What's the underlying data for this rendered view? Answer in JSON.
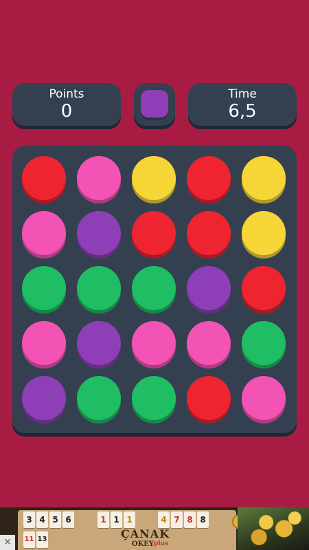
{
  "stats": {
    "points_label": "Points",
    "points_value": "0",
    "time_label": "Time",
    "time_value": "6,5"
  },
  "target": {
    "color_name": "purple",
    "color": "#8E3FB8"
  },
  "palette": {
    "red": "#EE2430",
    "pink": "#F253B4",
    "yellow": "#F6D636",
    "purple": "#8E3FB8",
    "green": "#1FBD64"
  },
  "board": {
    "rows": [
      [
        "red",
        "pink",
        "yellow",
        "red",
        "yellow"
      ],
      [
        "pink",
        "purple",
        "red",
        "red",
        "yellow"
      ],
      [
        "green",
        "green",
        "green",
        "purple",
        "red"
      ],
      [
        "pink",
        "purple",
        "pink",
        "pink",
        "green"
      ],
      [
        "purple",
        "green",
        "green",
        "red",
        "pink"
      ]
    ]
  },
  "ad": {
    "close": "✕",
    "tiles": [
      {
        "text": "3",
        "color": "#222222"
      },
      {
        "text": "4",
        "color": "#222222"
      },
      {
        "text": "5",
        "color": "#222222"
      },
      {
        "text": "6",
        "color": "#222222"
      },
      {
        "text": "1",
        "color": "#C7332B"
      },
      {
        "text": "1",
        "color": "#222222"
      },
      {
        "text": "1",
        "color": "#B8860B"
      },
      {
        "text": "4",
        "color": "#B8860B"
      },
      {
        "text": "7",
        "color": "#C7332B"
      },
      {
        "text": "8",
        "color": "#C7332B"
      },
      {
        "text": "8",
        "color": "#222222"
      },
      {
        "text": "11",
        "color": "#C7332B"
      },
      {
        "text": "13",
        "color": "#222222"
      }
    ],
    "logo_line1": "ÇANAK",
    "logo_line2": "OKEY",
    "logo_plus": "plus"
  }
}
